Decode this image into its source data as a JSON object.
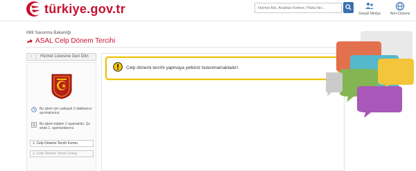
{
  "header": {
    "logo_text": "türkiye.gov.tr",
    "search_placeholder": "Hizmet Adı, Anahtar Kelime, Plaka No...",
    "buttons": [
      {
        "label": "Sosyal Medya",
        "icon": "social-media-icon"
      },
      {
        "label": "Non-Citizens",
        "icon": "globe-icon"
      }
    ]
  },
  "page": {
    "breadcrumb": "Millî Savunma Bakanlığı",
    "title": "ASAL Celp Dönem Tercihi"
  },
  "sidebar": {
    "back_label": "Hizmet Listesine Geri Dön",
    "duration_text": "Bu işlem için yaklaşık 3 dakikanızı ayırmalısınız.",
    "stages_text": "Bu işlem toplam 2 aşamalıdır. Şu anda 1. aşamadasınız.",
    "steps": [
      {
        "label": "1. Celp Dönemi Tercih Formu"
      },
      {
        "label": "2. Celp Dönemi Tercih Sonuç"
      }
    ]
  },
  "main": {
    "alert_message": "Celp dönemi tercihi yapmaya yetkiniz bulunmamaktadır!."
  },
  "colors": {
    "brand_red": "#c8102e",
    "alert_border": "#f0c000",
    "search_button": "#3a6fb0"
  }
}
